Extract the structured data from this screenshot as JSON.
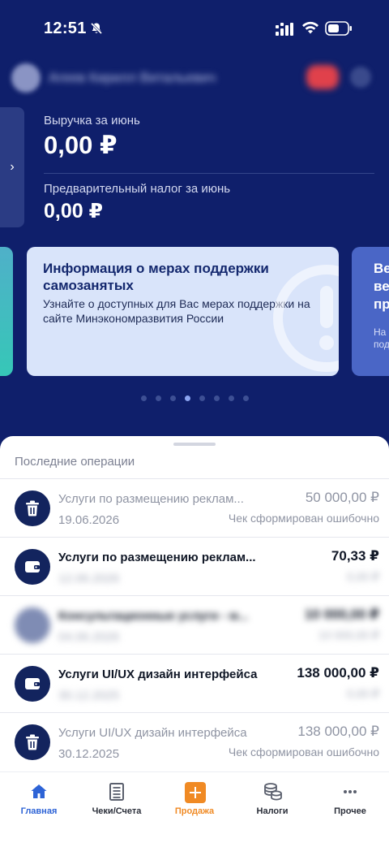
{
  "status_bar": {
    "time": "12:51"
  },
  "profile": {
    "name": "Агеев Кирилл Витальевич"
  },
  "revenue": {
    "label": "Выручка за июнь",
    "value": "0,00 ₽",
    "tax_label": "Предварительный налог за июнь",
    "tax_value": "0,00 ₽"
  },
  "carousel": {
    "card": {
      "title": "Информация о мерах поддержки самозанятых",
      "text": "Узнайте о доступных для Вас мерах поддержки на сайте Минэкономразвития России"
    },
    "peek": {
      "title": "Ве\nве\nпр",
      "text": "На\nпод"
    },
    "dots_total": 8,
    "dots_active": 3
  },
  "operations": {
    "title": "Последние операции",
    "items": [
      {
        "icon": "trash-icon",
        "title": "Услуги по размещению реклам...",
        "date": "19.06.2026",
        "amount": "50 000,00 ₽",
        "status": "Чек сформирован ошибочно",
        "cancelled": true,
        "blur_date": false,
        "blur_status": false,
        "blur_all": false
      },
      {
        "icon": "wallet-icon",
        "title": "Услуги по размещению реклам...",
        "date": "12.06.2026",
        "amount": "70,33 ₽",
        "status": "0,00 ₽",
        "cancelled": false,
        "blur_date": true,
        "blur_status": true,
        "blur_all": false
      },
      {
        "icon": "avatar-icon",
        "title": "Консультационные услуги - м...",
        "date": "04.06.2026",
        "amount": "10 000,00 ₽",
        "status": "10 000,00 ₽",
        "cancelled": false,
        "blur_date": true,
        "blur_status": true,
        "blur_all": true
      },
      {
        "icon": "wallet-icon",
        "title": "Услуги UI/UX дизайн интерфейса",
        "date": "30.12.2025",
        "amount": "138 000,00 ₽",
        "status": "0,00 ₽",
        "cancelled": false,
        "blur_date": true,
        "blur_status": true,
        "blur_all": false
      },
      {
        "icon": "trash-icon",
        "title": "Услуги UI/UX дизайн интерфейса",
        "date": "30.12.2025",
        "amount": "138 000,00 ₽",
        "status": "Чек сформирован ошибочно",
        "cancelled": true,
        "blur_date": false,
        "blur_status": false,
        "blur_all": false
      }
    ]
  },
  "tabs": [
    {
      "label": "Главная",
      "icon": "home-icon",
      "state": "active"
    },
    {
      "label": "Чеки/Счета",
      "icon": "receipt-icon",
      "state": ""
    },
    {
      "label": "Продажа",
      "icon": "plus-icon",
      "state": "sale"
    },
    {
      "label": "Налоги",
      "icon": "coins-icon",
      "state": ""
    },
    {
      "label": "Прочее",
      "icon": "more-icon",
      "state": ""
    }
  ],
  "colors": {
    "background": "#0f1f6b",
    "accent": "#2d63d6",
    "sale": "#f08a24",
    "card": "#d9e4fa"
  }
}
